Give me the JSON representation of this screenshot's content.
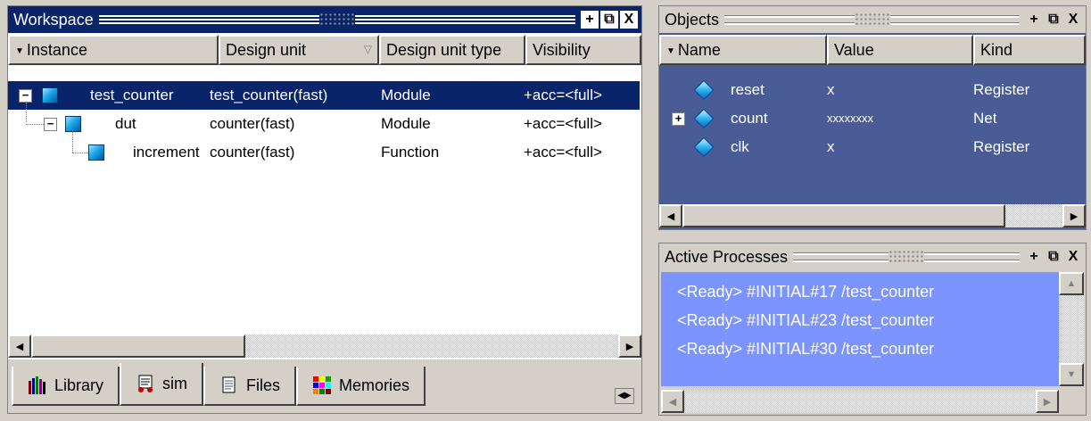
{
  "workspace": {
    "title": "Workspace",
    "columns": [
      "Instance",
      "Design unit",
      "Design unit type",
      "Visibility"
    ],
    "rows": [
      {
        "instance": "test_counter",
        "unit": "test_counter(fast)",
        "type": "Module",
        "visibility": "+acc=<full>"
      },
      {
        "instance": "dut",
        "unit": "counter(fast)",
        "type": "Module",
        "visibility": "+acc=<full>"
      },
      {
        "instance": "increment",
        "unit": "counter(fast)",
        "type": "Function",
        "visibility": "+acc=<full>"
      }
    ],
    "tabs": [
      "Library",
      "sim",
      "Files",
      "Memories"
    ]
  },
  "objects": {
    "title": "Objects",
    "columns": [
      "Name",
      "Value",
      "Kind"
    ],
    "rows": [
      {
        "name": "reset",
        "value": "x",
        "kind": "Register"
      },
      {
        "name": "count",
        "value": "xxxxxxxx",
        "kind": "Net"
      },
      {
        "name": "clk",
        "value": "x",
        "kind": "Register"
      }
    ]
  },
  "processes": {
    "title": "Active Processes",
    "lines": [
      "<Ready>  #INITIAL#17 /test_counter",
      "<Ready>  #INITIAL#23 /test_counter",
      "<Ready>  #INITIAL#30 /test_counter"
    ]
  },
  "window_buttons": {
    "dock": "+",
    "undock": "⧉",
    "close": "X"
  },
  "colors": {
    "title_active": "#0a246a",
    "selection": "#0a246a",
    "objects_bg": "#4a5c96",
    "processes_bg": "#7b94ff"
  }
}
